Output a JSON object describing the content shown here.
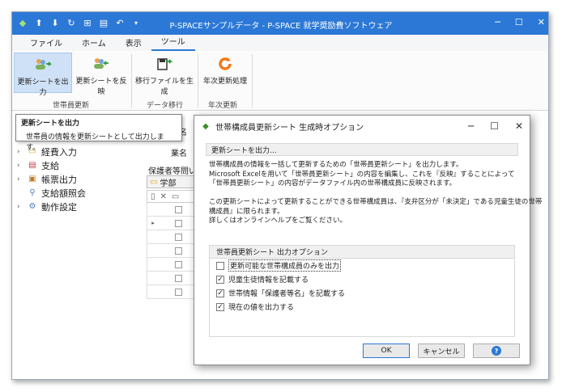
{
  "window": {
    "title": "P-SPACEサンプルデータ - P-SPACE 就学奨励費ソフトウェア",
    "qat_icons": [
      "app-icon",
      "up-circle-icon",
      "down-circle-icon",
      "refresh-icon",
      "grid-icon",
      "save-as-icon",
      "undo-icon",
      "dropdown-icon"
    ],
    "controls": [
      "minimize",
      "maximize",
      "close"
    ]
  },
  "menu": {
    "items": [
      "ファイル",
      "ホーム",
      "表示",
      "ツール"
    ],
    "active": "ツール"
  },
  "ribbon": {
    "buttons": [
      {
        "label": "更新シートを出力",
        "icon": "users-export-icon"
      },
      {
        "label": "更新シートを反映",
        "icon": "users-import-icon"
      },
      {
        "label": "移行ファイルを生成",
        "icon": "file-export-icon"
      },
      {
        "label": "年次更新処理",
        "icon": "yearly-update-icon"
      }
    ],
    "groups": [
      "世帯員更新",
      "データ移行",
      "年次更新"
    ]
  },
  "tooltip": {
    "title": "更新シートを出力",
    "description": "世帯員の情報を更新シートとして出力します。"
  },
  "nav": {
    "items": [
      "経費入力",
      "支給",
      "帳票出力",
      "支給額照会",
      "動作設定"
    ]
  },
  "main": {
    "label_fragment_1": "名",
    "label_fragment_2": "業名",
    "label_fragment_3": "保護者等問い合",
    "tab_label": "学部"
  },
  "dialog": {
    "title": "世帯構成員更新シート 生成時オプション",
    "section_title": "更新シートを出力...",
    "desc_lines": [
      "世帯構成員の情報を一括して更新するための「世帯員更新シート」を出力します。",
      "Microsoft Excelを用いて「世帯員更新シート」の内容を編集し、これを『反映』することによって",
      "「世帯員更新シート」の内容がデータファイル内の世帯構成員に反映されます。",
      "",
      "この更新シートによって更新することができる世帯構成員は、『支弁区分が「未決定」である児童生徒の世帯",
      "構成員』に限られます。",
      "詳しくはオンラインヘルプをご覧ください。"
    ],
    "options_title": "世帯員更新シート 出力オプション",
    "options": [
      {
        "label": "更新可能な世帯構成員のみを出力",
        "checked": false
      },
      {
        "label": "児童生徒情報を記載する",
        "checked": true
      },
      {
        "label": "世帯情報「保護者等名」を記載する",
        "checked": true
      },
      {
        "label": "現在の値を出力する",
        "checked": true
      }
    ],
    "ok_label": "OK",
    "cancel_label": "キャンセル",
    "help_symbol": "?"
  }
}
